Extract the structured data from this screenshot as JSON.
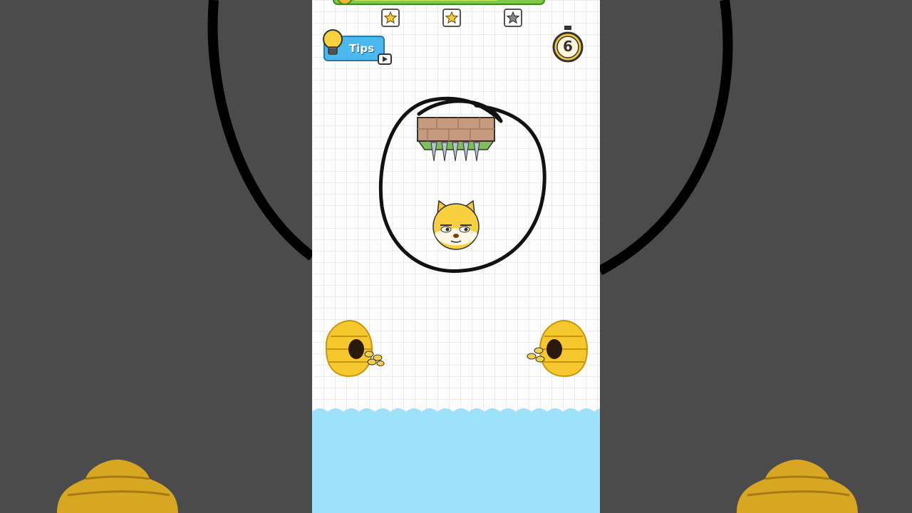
{
  "level": {
    "stars": [
      {
        "name": "star-1",
        "filled": true
      },
      {
        "name": "star-2",
        "filled": true
      },
      {
        "name": "star-3",
        "filled": false
      }
    ]
  },
  "tips_button": {
    "label": "Tips"
  },
  "timer": {
    "seconds_left": "6"
  },
  "colors": {
    "background": "#4b4b4b",
    "grid": "#ececec",
    "water": "#9ee1fb",
    "tips_button": "#4bb8ee",
    "star_filled": "#f6c93a",
    "star_empty": "#888888"
  }
}
